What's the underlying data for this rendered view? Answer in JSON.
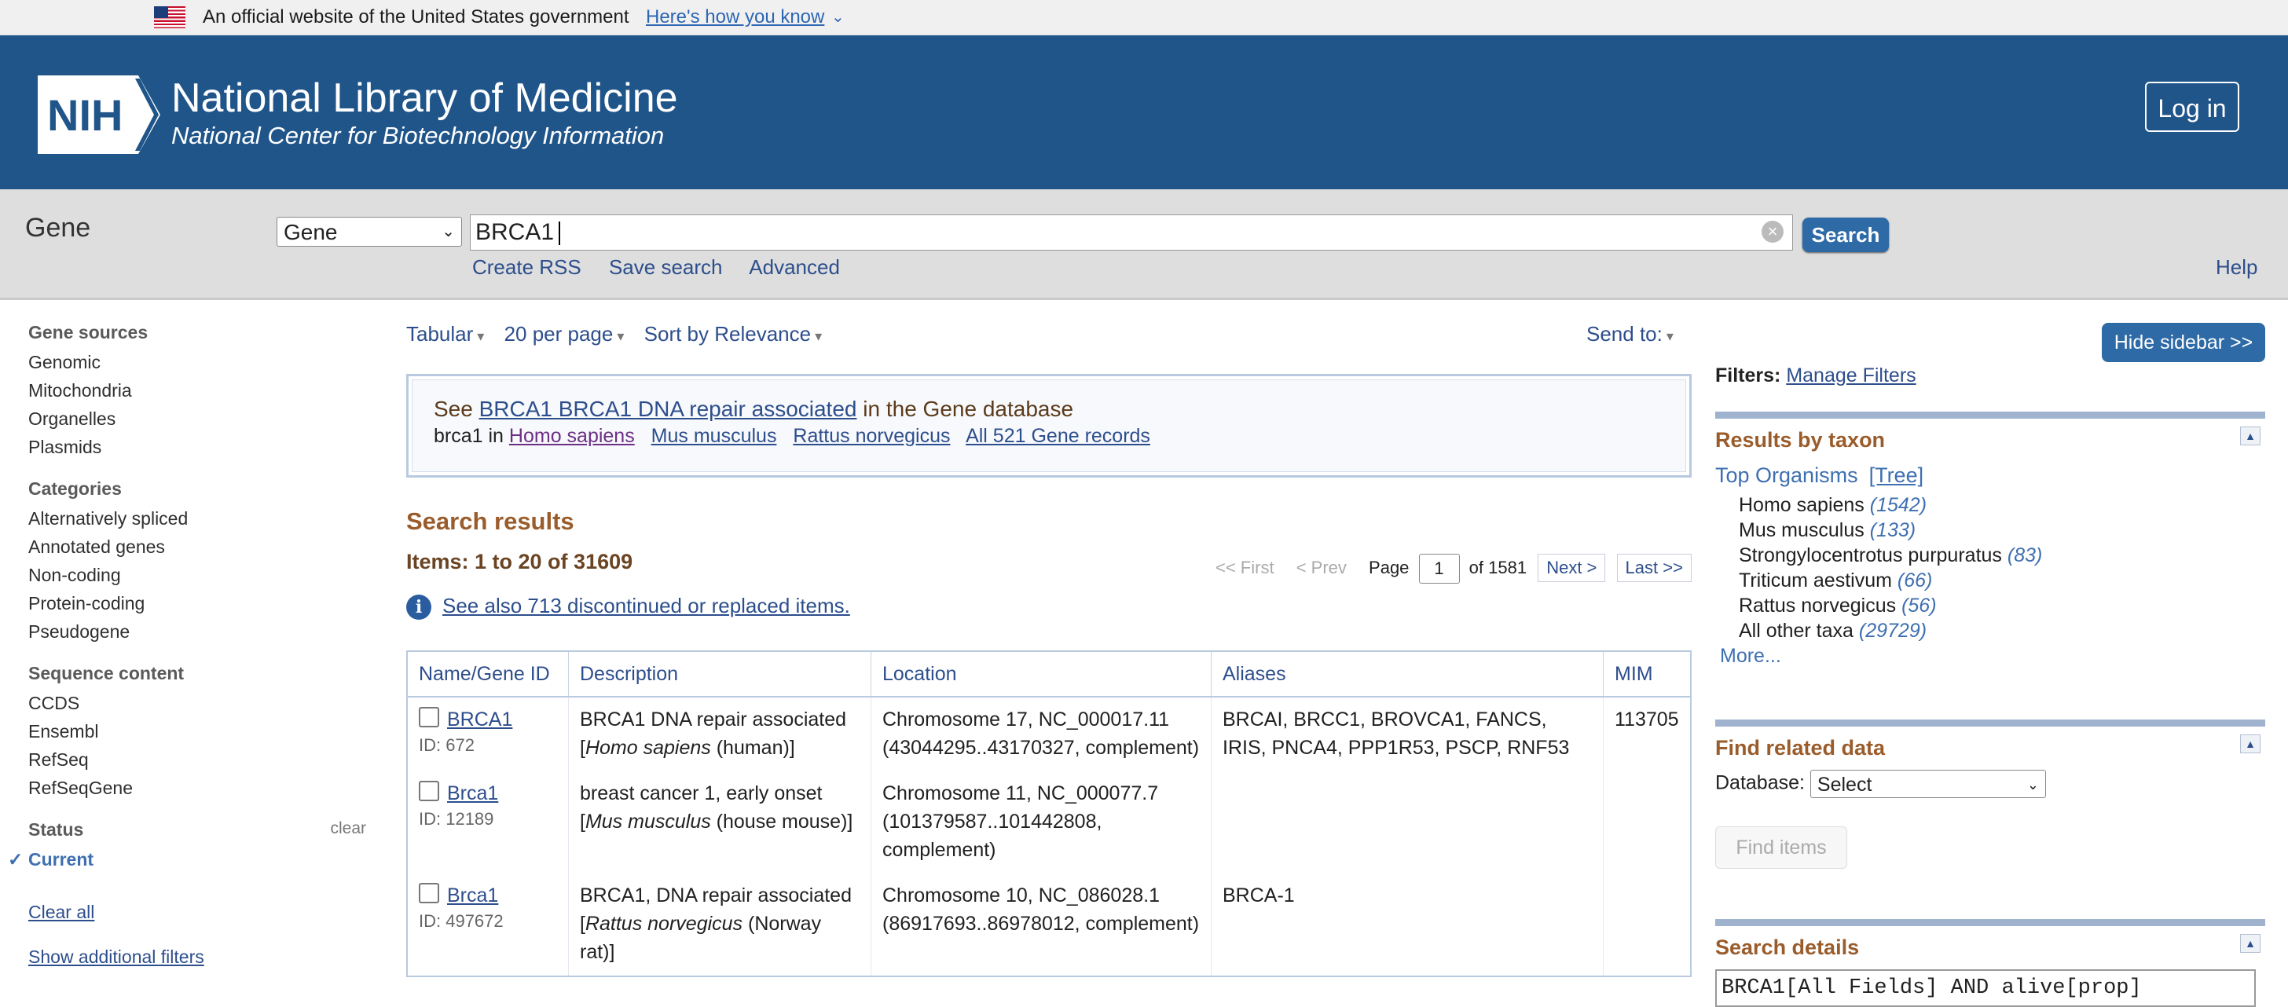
{
  "gov_banner": {
    "text": "An official website of the United States government",
    "link": "Here's how you know",
    "chevron": "⌄"
  },
  "header": {
    "logo_text": "NIH",
    "title": "National Library of Medicine",
    "subtitle": "National Center for Biotechnology Information",
    "login": "Log in",
    "bg_color": "#20558a"
  },
  "search": {
    "db_name": "Gene",
    "db_select": "Gene",
    "query": "BRCA1",
    "button": "Search",
    "links": [
      "Create RSS",
      "Save search",
      "Advanced"
    ],
    "help": "Help"
  },
  "left_sidebar": {
    "groups": [
      {
        "title": "Gene sources",
        "items": [
          "Genomic",
          "Mitochondria",
          "Organelles",
          "Plasmids"
        ]
      },
      {
        "title": "Categories",
        "items": [
          "Alternatively spliced",
          "Annotated genes",
          "Non-coding",
          "Protein-coding",
          "Pseudogene"
        ]
      },
      {
        "title": "Sequence content",
        "items": [
          "CCDS",
          "Ensembl",
          "RefSeq",
          "RefSeqGene"
        ]
      },
      {
        "title": "Status",
        "clear": "clear",
        "items": [
          "Current"
        ]
      }
    ],
    "clear_all": "Clear all",
    "show_additional": "Show additional filters"
  },
  "toolbar": {
    "format": "Tabular",
    "per_page": "20 per page",
    "sort": "Sort by Relevance",
    "send_to": "Send to:"
  },
  "sensor": {
    "see": "See",
    "gene_link": "BRCA1 BRCA1 DNA repair associated",
    "in_db": "in the Gene database",
    "prefix": "brca1 in",
    "organisms": [
      "Homo sapiens",
      "Mus musculus",
      "Rattus norvegicus",
      "All 521 Gene records"
    ]
  },
  "results": {
    "title": "Search results",
    "items": "Items: 1 to 20 of 31609",
    "pager": {
      "first": "<< First",
      "prev": "< Prev",
      "page_label": "Page",
      "page": "1",
      "of": "of 1581",
      "next": "Next >",
      "last": "Last >>"
    },
    "see_also": "See also 713 discontinued or replaced items.",
    "info_icon": "i",
    "columns": [
      "Name/Gene ID",
      "Description",
      "Location",
      "Aliases",
      "MIM"
    ],
    "rows": [
      {
        "name": "BRCA1",
        "id": "ID: 672",
        "desc_pre": "BRCA1 DNA repair associated [",
        "desc_org": "Homo sapiens",
        "desc_post": " (human)]",
        "location": "Chromosome 17, NC_000017.11 (43044295..43170327, complement)",
        "aliases": "BRCAI, BRCC1, BROVCA1, FANCS, IRIS, PNCA4, PPP1R53, PSCP, RNF53",
        "mim": "113705"
      },
      {
        "name": "Brca1",
        "id": "ID: 12189",
        "desc_pre": "breast cancer 1, early onset [",
        "desc_org": "Mus musculus",
        "desc_post": " (house mouse)]",
        "location": "Chromosome 11, NC_000077.7 (101379587..101442808, complement)",
        "aliases": "",
        "mim": ""
      },
      {
        "name": "Brca1",
        "id": "ID: 497672",
        "desc_pre": "BRCA1, DNA repair associated [",
        "desc_org": "Rattus norvegicus",
        "desc_post": " (Norway rat)]",
        "location": "Chromosome 10, NC_086028.1 (86917693..86978012, complement)",
        "aliases": "BRCA-1",
        "mim": ""
      }
    ]
  },
  "right_sidebar": {
    "hide_button": "Hide sidebar >>",
    "filters_label": "Filters:",
    "manage_filters": "Manage Filters",
    "taxon": {
      "title": "Results by taxon",
      "top": "Top Organisms",
      "tree": "[Tree]",
      "organisms": [
        {
          "name": "Homo sapiens",
          "count": "(1542)"
        },
        {
          "name": "Mus musculus",
          "count": "(133)"
        },
        {
          "name": "Strongylocentrotus purpuratus",
          "count": "(83)"
        },
        {
          "name": "Triticum aestivum",
          "count": "(66)"
        },
        {
          "name": "Rattus norvegicus",
          "count": "(56)"
        },
        {
          "name": "All other taxa",
          "count": "(29729)"
        }
      ],
      "more": "More..."
    },
    "related": {
      "title": "Find related data",
      "db_label": "Database:",
      "db_select": "Select",
      "find_items": "Find items"
    },
    "details": {
      "title": "Search details",
      "query": "BRCA1[All Fields] AND alive[prop]"
    }
  }
}
